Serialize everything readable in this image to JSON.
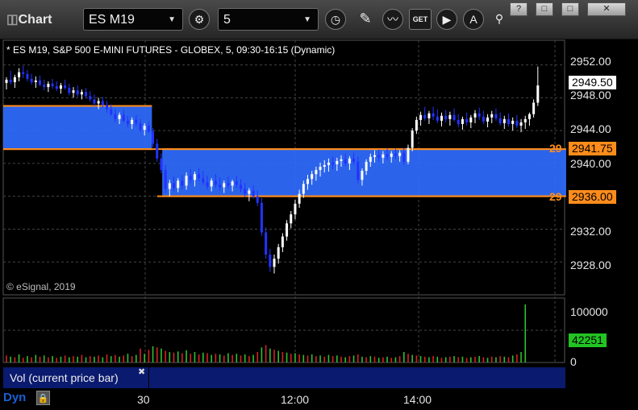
{
  "window": {
    "title": "Chart",
    "symbol": "ES M19",
    "interval": "5",
    "controls": [
      "?",
      "□",
      "□",
      "✕"
    ]
  },
  "chart_header": "* ES M19, S&P 500 E-MINI FUTURES - GLOBEX, 5, 09:30-16:15 (Dynamic)",
  "copyright": "© eSignal, 2019",
  "price_axis": {
    "ticks": [
      "2952.00",
      "2948.00",
      "2944.00",
      "2940.00",
      "2932.00",
      "2928.00"
    ],
    "last_price": "2949.50",
    "level_high": "2941.75",
    "level_low": "2936.00",
    "level_prefix": "29"
  },
  "volume_axis": {
    "ticks": [
      "100000",
      "0"
    ],
    "last_volume": "42251"
  },
  "time_axis": [
    "30",
    "12:00",
    "14:00"
  ],
  "study_tab": "Vol (current price bar)",
  "footer": {
    "mode": "Dyn"
  },
  "colors": {
    "zone": "#2f6bff",
    "zone_line": "#ff8c1a",
    "up": "#ffffff",
    "down": "#2233ff",
    "grid": "#444444",
    "vol_up": "#2fbf2f",
    "vol_down": "#d82020"
  },
  "chart_data": {
    "type": "candlestick",
    "ylim": [
      2924,
      2955
    ],
    "zones": [
      {
        "from_bar": 0,
        "to_bar": 34,
        "low": 2941.75,
        "high": 2947.0
      },
      {
        "from_bar": 38,
        "to_bar": 133,
        "low": 2936.0,
        "high": 2941.75
      }
    ],
    "candles": [
      [
        2949.8,
        2950.5,
        2949.0,
        2950.2
      ],
      [
        2950.2,
        2951.3,
        2949.6,
        2949.9
      ],
      [
        2949.9,
        2950.8,
        2949.2,
        2950.5
      ],
      [
        2950.5,
        2951.6,
        2950.0,
        2951.1
      ],
      [
        2951.1,
        2951.9,
        2950.4,
        2950.9
      ],
      [
        2950.9,
        2951.4,
        2950.0,
        2950.3
      ],
      [
        2950.3,
        2950.9,
        2949.6,
        2949.9
      ],
      [
        2949.9,
        2950.6,
        2949.2,
        2950.1
      ],
      [
        2950.1,
        2950.7,
        2949.4,
        2949.6
      ],
      [
        2949.6,
        2950.2,
        2948.9,
        2949.3
      ],
      [
        2949.3,
        2950.0,
        2948.7,
        2949.7
      ],
      [
        2949.7,
        2950.3,
        2949.1,
        2949.4
      ],
      [
        2949.4,
        2950.0,
        2948.8,
        2949.1
      ],
      [
        2949.1,
        2949.8,
        2948.5,
        2949.5
      ],
      [
        2949.5,
        2950.2,
        2949.0,
        2949.2
      ],
      [
        2949.2,
        2949.7,
        2948.3,
        2948.6
      ],
      [
        2948.6,
        2949.3,
        2948.0,
        2948.9
      ],
      [
        2948.9,
        2949.5,
        2948.1,
        2948.4
      ],
      [
        2948.4,
        2949.0,
        2947.8,
        2948.7
      ],
      [
        2948.7,
        2949.2,
        2947.9,
        2948.2
      ],
      [
        2948.2,
        2948.8,
        2947.5,
        2947.8
      ],
      [
        2947.8,
        2948.4,
        2947.0,
        2947.3
      ],
      [
        2947.3,
        2948.0,
        2946.6,
        2947.6
      ],
      [
        2947.6,
        2948.1,
        2946.8,
        2947.1
      ],
      [
        2947.1,
        2947.6,
        2946.2,
        2946.6
      ],
      [
        2946.6,
        2947.2,
        2945.8,
        2946.0
      ],
      [
        2946.0,
        2946.6,
        2945.0,
        2945.4
      ],
      [
        2945.4,
        2946.2,
        2944.8,
        2945.9
      ],
      [
        2945.9,
        2946.5,
        2945.0,
        2945.2
      ],
      [
        2945.2,
        2945.8,
        2944.4,
        2944.8
      ],
      [
        2944.8,
        2945.6,
        2944.2,
        2945.3
      ],
      [
        2945.3,
        2945.9,
        2944.5,
        2944.9
      ],
      [
        2944.9,
        2945.4,
        2943.8,
        2944.1
      ],
      [
        2944.1,
        2944.9,
        2943.4,
        2944.6
      ],
      [
        2944.6,
        2945.1,
        2943.7,
        2943.9
      ],
      [
        2943.9,
        2944.3,
        2942.0,
        2942.4
      ],
      [
        2942.4,
        2943.0,
        2940.2,
        2940.6
      ],
      [
        2940.6,
        2941.2,
        2938.8,
        2939.2
      ],
      [
        2939.2,
        2939.8,
        2936.4,
        2936.9
      ],
      [
        2936.9,
        2938.0,
        2936.0,
        2937.6
      ],
      [
        2937.6,
        2938.4,
        2936.6,
        2937.0
      ],
      [
        2937.0,
        2938.2,
        2936.5,
        2937.9
      ],
      [
        2937.9,
        2938.6,
        2936.9,
        2937.3
      ],
      [
        2937.3,
        2938.9,
        2936.8,
        2938.5
      ],
      [
        2938.5,
        2939.3,
        2937.6,
        2938.0
      ],
      [
        2938.0,
        2939.0,
        2937.2,
        2938.7
      ],
      [
        2938.7,
        2939.4,
        2937.8,
        2938.2
      ],
      [
        2938.2,
        2939.1,
        2937.4,
        2937.7
      ],
      [
        2937.7,
        2938.5,
        2936.8,
        2937.2
      ],
      [
        2937.2,
        2938.2,
        2936.6,
        2937.9
      ],
      [
        2937.9,
        2938.7,
        2937.0,
        2937.4
      ],
      [
        2937.4,
        2938.3,
        2936.7,
        2937.1
      ],
      [
        2937.1,
        2937.9,
        2936.4,
        2937.6
      ],
      [
        2937.6,
        2938.4,
        2936.9,
        2937.3
      ],
      [
        2937.3,
        2938.0,
        2936.6,
        2937.8
      ],
      [
        2937.8,
        2938.5,
        2937.0,
        2937.4
      ],
      [
        2937.4,
        2938.1,
        2936.5,
        2936.9
      ],
      [
        2936.9,
        2937.6,
        2935.9,
        2936.3
      ],
      [
        2936.3,
        2937.0,
        2935.4,
        2936.7
      ],
      [
        2936.7,
        2937.3,
        2935.7,
        2936.0
      ],
      [
        2936.0,
        2936.7,
        2934.8,
        2935.2
      ],
      [
        2935.2,
        2935.8,
        2931.2,
        2931.6
      ],
      [
        2931.6,
        2932.2,
        2928.4,
        2928.9
      ],
      [
        2928.9,
        2929.6,
        2926.8,
        2927.4
      ],
      [
        2927.4,
        2928.9,
        2926.6,
        2928.4
      ],
      [
        2928.4,
        2930.2,
        2927.8,
        2929.8
      ],
      [
        2929.8,
        2931.5,
        2929.2,
        2931.1
      ],
      [
        2931.1,
        2933.1,
        2930.6,
        2932.7
      ],
      [
        2932.7,
        2934.2,
        2932.1,
        2933.8
      ],
      [
        2933.8,
        2935.6,
        2933.2,
        2935.1
      ],
      [
        2935.1,
        2936.8,
        2934.6,
        2936.3
      ],
      [
        2936.3,
        2937.9,
        2935.8,
        2937.5
      ],
      [
        2937.5,
        2938.6,
        2936.8,
        2938.1
      ],
      [
        2938.1,
        2939.1,
        2937.4,
        2938.7
      ],
      [
        2938.7,
        2939.6,
        2937.9,
        2939.2
      ],
      [
        2939.2,
        2940.1,
        2938.4,
        2939.6
      ],
      [
        2939.6,
        2940.4,
        2938.9,
        2939.8
      ],
      [
        2939.8,
        2940.6,
        2939.0,
        2940.1
      ],
      [
        2940.1,
        2940.8,
        2939.3,
        2939.9
      ],
      [
        2939.9,
        2940.7,
        2939.1,
        2940.3
      ],
      [
        2940.3,
        2941.0,
        2939.6,
        2940.5
      ],
      [
        2940.5,
        2941.2,
        2939.7,
        2940.0
      ],
      [
        2940.0,
        2940.9,
        2939.2,
        2940.6
      ],
      [
        2940.6,
        2941.3,
        2939.8,
        2940.2
      ],
      [
        2940.2,
        2940.8,
        2937.6,
        2938.0
      ],
      [
        2938.0,
        2939.4,
        2937.3,
        2939.1
      ],
      [
        2939.1,
        2940.5,
        2938.6,
        2940.2
      ],
      [
        2940.2,
        2941.2,
        2939.6,
        2940.8
      ],
      [
        2940.8,
        2941.6,
        2940.1,
        2941.0
      ],
      [
        2941.0,
        2941.7,
        2940.3,
        2940.7
      ],
      [
        2940.7,
        2941.5,
        2940.0,
        2941.1
      ],
      [
        2941.1,
        2941.8,
        2940.4,
        2940.8
      ],
      [
        2940.8,
        2941.5,
        2940.1,
        2941.2
      ],
      [
        2941.2,
        2941.8,
        2940.5,
        2940.9
      ],
      [
        2940.9,
        2941.6,
        2940.2,
        2941.3
      ],
      [
        2941.3,
        2941.9,
        2939.8,
        2940.2
      ],
      [
        2940.2,
        2942.3,
        2939.9,
        2941.9
      ],
      [
        2941.9,
        2944.3,
        2941.5,
        2944.0
      ],
      [
        2944.0,
        2945.7,
        2943.6,
        2945.3
      ],
      [
        2945.3,
        2946.3,
        2944.6,
        2945.9
      ],
      [
        2945.9,
        2946.9,
        2945.2,
        2945.5
      ],
      [
        2945.5,
        2946.4,
        2944.8,
        2946.1
      ],
      [
        2946.1,
        2946.9,
        2945.3,
        2945.7
      ],
      [
        2945.7,
        2946.6,
        2944.9,
        2945.2
      ],
      [
        2945.2,
        2946.2,
        2944.5,
        2945.8
      ],
      [
        2945.8,
        2946.5,
        2945.0,
        2945.4
      ],
      [
        2945.4,
        2946.3,
        2944.6,
        2945.9
      ],
      [
        2945.9,
        2946.7,
        2945.1,
        2945.3
      ],
      [
        2945.3,
        2946.0,
        2944.4,
        2944.8
      ],
      [
        2944.8,
        2945.7,
        2944.1,
        2945.4
      ],
      [
        2945.4,
        2946.2,
        2944.6,
        2945.0
      ],
      [
        2945.0,
        2945.9,
        2944.3,
        2945.6
      ],
      [
        2945.6,
        2946.5,
        2944.9,
        2946.1
      ],
      [
        2946.1,
        2946.8,
        2945.3,
        2945.7
      ],
      [
        2945.7,
        2946.4,
        2944.8,
        2945.1
      ],
      [
        2945.1,
        2946.0,
        2944.4,
        2945.6
      ],
      [
        2945.6,
        2946.4,
        2944.9,
        2946.0
      ],
      [
        2946.0,
        2946.7,
        2945.2,
        2945.5
      ],
      [
        2945.5,
        2946.2,
        2944.6,
        2944.9
      ],
      [
        2944.9,
        2945.8,
        2944.2,
        2945.4
      ],
      [
        2945.4,
        2946.1,
        2944.5,
        2944.8
      ],
      [
        2944.8,
        2945.6,
        2944.0,
        2945.2
      ],
      [
        2945.2,
        2945.9,
        2944.3,
        2944.6
      ],
      [
        2944.6,
        2945.4,
        2943.8,
        2945.0
      ],
      [
        2945.0,
        2945.8,
        2944.2,
        2945.4
      ],
      [
        2945.4,
        2946.2,
        2944.6,
        2946.0
      ],
      [
        2946.0,
        2947.8,
        2945.6,
        2947.4
      ],
      [
        2947.4,
        2951.8,
        2947.0,
        2949.5
      ]
    ],
    "volume": [
      [
        12,
        0
      ],
      [
        10,
        1
      ],
      [
        9,
        0
      ],
      [
        14,
        1
      ],
      [
        8,
        0
      ],
      [
        11,
        1
      ],
      [
        9,
        0
      ],
      [
        13,
        1
      ],
      [
        10,
        0
      ],
      [
        12,
        1
      ],
      [
        9,
        0
      ],
      [
        11,
        1
      ],
      [
        8,
        0
      ],
      [
        10,
        1
      ],
      [
        12,
        0
      ],
      [
        9,
        1
      ],
      [
        11,
        0
      ],
      [
        10,
        1
      ],
      [
        13,
        0
      ],
      [
        9,
        1
      ],
      [
        11,
        0
      ],
      [
        10,
        1
      ],
      [
        12,
        0
      ],
      [
        9,
        1
      ],
      [
        14,
        0
      ],
      [
        11,
        1
      ],
      [
        13,
        0
      ],
      [
        10,
        1
      ],
      [
        12,
        0
      ],
      [
        15,
        1
      ],
      [
        11,
        0
      ],
      [
        13,
        1
      ],
      [
        24,
        0
      ],
      [
        15,
        1
      ],
      [
        22,
        0
      ],
      [
        28,
        1
      ],
      [
        26,
        0
      ],
      [
        24,
        1
      ],
      [
        20,
        0
      ],
      [
        18,
        1
      ],
      [
        17,
        0
      ],
      [
        19,
        1
      ],
      [
        16,
        0
      ],
      [
        21,
        1
      ],
      [
        15,
        0
      ],
      [
        18,
        1
      ],
      [
        14,
        0
      ],
      [
        17,
        1
      ],
      [
        16,
        0
      ],
      [
        13,
        1
      ],
      [
        15,
        0
      ],
      [
        14,
        1
      ],
      [
        12,
        0
      ],
      [
        16,
        1
      ],
      [
        13,
        0
      ],
      [
        15,
        1
      ],
      [
        12,
        0
      ],
      [
        14,
        1
      ],
      [
        11,
        0
      ],
      [
        13,
        1
      ],
      [
        18,
        0
      ],
      [
        26,
        1
      ],
      [
        30,
        0
      ],
      [
        24,
        1
      ],
      [
        22,
        0
      ],
      [
        20,
        1
      ],
      [
        18,
        0
      ],
      [
        17,
        1
      ],
      [
        15,
        0
      ],
      [
        16,
        1
      ],
      [
        14,
        0
      ],
      [
        13,
        1
      ],
      [
        12,
        0
      ],
      [
        14,
        1
      ],
      [
        11,
        0
      ],
      [
        12,
        1
      ],
      [
        10,
        0
      ],
      [
        13,
        1
      ],
      [
        11,
        0
      ],
      [
        12,
        1
      ],
      [
        10,
        0
      ],
      [
        9,
        1
      ],
      [
        11,
        0
      ],
      [
        12,
        1
      ],
      [
        14,
        0
      ],
      [
        10,
        1
      ],
      [
        9,
        0
      ],
      [
        11,
        1
      ],
      [
        10,
        0
      ],
      [
        8,
        1
      ],
      [
        9,
        0
      ],
      [
        10,
        1
      ],
      [
        8,
        0
      ],
      [
        9,
        1
      ],
      [
        11,
        0
      ],
      [
        18,
        1
      ],
      [
        15,
        0
      ],
      [
        13,
        1
      ],
      [
        12,
        0
      ],
      [
        11,
        1
      ],
      [
        10,
        0
      ],
      [
        9,
        1
      ],
      [
        11,
        0
      ],
      [
        10,
        1
      ],
      [
        8,
        0
      ],
      [
        9,
        1
      ],
      [
        10,
        0
      ],
      [
        11,
        1
      ],
      [
        9,
        0
      ],
      [
        10,
        1
      ],
      [
        8,
        0
      ],
      [
        9,
        1
      ],
      [
        10,
        0
      ],
      [
        11,
        1
      ],
      [
        9,
        0
      ],
      [
        8,
        1
      ],
      [
        10,
        0
      ],
      [
        9,
        1
      ],
      [
        11,
        0
      ],
      [
        10,
        1
      ],
      [
        9,
        0
      ],
      [
        12,
        1
      ],
      [
        14,
        0
      ],
      [
        18,
        1
      ],
      [
        100,
        1
      ]
    ]
  }
}
